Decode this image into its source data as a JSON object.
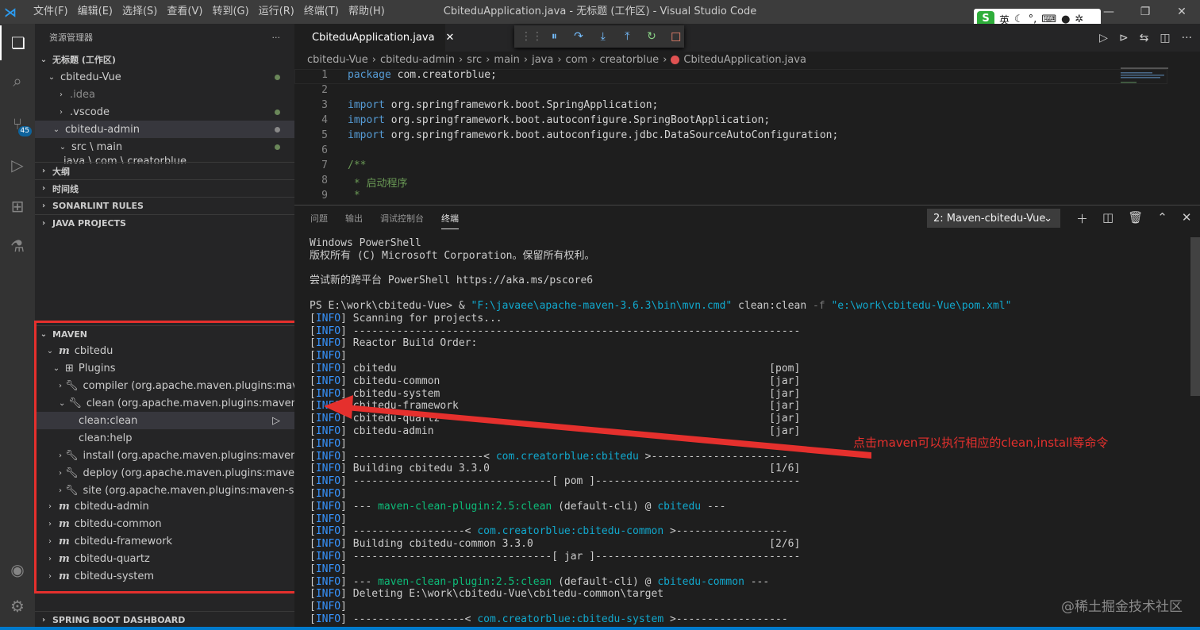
{
  "menu": [
    "文件(F)",
    "编辑(E)",
    "选择(S)",
    "查看(V)",
    "转到(G)",
    "运行(R)",
    "终端(T)",
    "帮助(H)"
  ],
  "window_title": "CbiteduApplication.java - 无标题 (工作区) - Visual Studio Code",
  "ime": {
    "mark": "S",
    "lang": "英"
  },
  "activity": {
    "scm_badge": "45"
  },
  "sidebar": {
    "header": "资源管理器",
    "more": "···",
    "workspace": "无标题 (工作区)",
    "tree": [
      "cbitedu-Vue",
      ".idea",
      ".vscode",
      "cbitedu-admin",
      "src \\ main",
      "java \\ com \\ creatorblue"
    ],
    "sections": [
      "大纲",
      "时间线",
      "SONARLINT RULES",
      "JAVA PROJECTS",
      "MAVEN",
      "SPRING BOOT DASHBOARD"
    ],
    "maven": {
      "root": "cbitedu",
      "plugins": "Plugins",
      "items": [
        "compiler (org.apache.maven.plugins:mav...",
        "clean (org.apache.maven.plugins:maven-c...",
        "clean:clean",
        "clean:help",
        "install (org.apache.maven.plugins:maven-...",
        "deploy (org.apache.maven.plugins:maven...",
        "site (org.apache.maven.plugins:maven-sit..."
      ],
      "modules": [
        "cbitedu-admin",
        "cbitedu-common",
        "cbitedu-framework",
        "cbitedu-quartz",
        "cbitedu-system"
      ]
    }
  },
  "editor": {
    "tab": "CbiteduApplication.java",
    "breadcrumb": [
      "cbitedu-Vue",
      "cbitedu-admin",
      "src",
      "main",
      "java",
      "com",
      "creatorblue",
      "CbiteduApplication.java"
    ],
    "lines": [
      "1",
      "2",
      "3",
      "4",
      "5",
      "6",
      "7",
      "8",
      "9"
    ],
    "code": {
      "l1a": "package",
      "l1b": " com.creatorblue;",
      "imp": "import",
      "l3": " org.springframework.boot.SpringApplication;",
      "l4": " org.springframework.boot.autoconfigure.SpringBootApplication;",
      "l5": " org.springframework.boot.autoconfigure.jdbc.DataSourceAutoConfiguration;",
      "l7": "/**",
      "l8": " * 启动程序",
      "l9": " *"
    }
  },
  "panel": {
    "tabs": [
      "问题",
      "输出",
      "调试控制台",
      "终端"
    ],
    "terminal_select": "2: Maven-cbitedu-Vue"
  },
  "terminal": {
    "t1": "Windows PowerShell",
    "t2": "版权所有 (C) Microsoft Corporation。保留所有权利。",
    "t3": "尝试新的跨平台 PowerShell https://aka.ms/pscore6",
    "ps": "PS E:\\work\\cbitedu-Vue> & ",
    "cmd": "\"F:\\javaee\\apache-maven-3.6.3\\bin\\mvn.cmd\"",
    "goal": " clean:clean ",
    "flag": "-f",
    "pom": " \"e:\\work\\cbitedu-Vue\\pom.xml\"",
    "info": "INFO",
    "lines": [
      " Scanning for projects...",
      " ------------------------------------------------------------------------",
      " Reactor Build Order:",
      "",
      " cbitedu                                                            [pom]",
      " cbitedu-common                                                     [jar]",
      " cbitedu-system                                                     [jar]",
      " cbitedu-framework                                                  [jar]",
      " cbitedu-quartz                                                     [jar]",
      " cbitedu-admin                                                      [jar]",
      ""
    ],
    "sep1a": " ---------------------< ",
    "sep1b": "com.creatorblue:cbitedu",
    "sep1c": " >----------------------",
    "b1": " Building cbitedu 3.3.0                                             [1/6]",
    "pom_line": " --------------------------------[ pom ]---------------------------------",
    "clean1a": " --- ",
    "clean1b": "maven-clean-plugin:2.5:clean",
    "clean1c": " (default-cli) @ ",
    "clean1d": "cbitedu",
    "clean1e": " ---",
    "sep2a": " ------------------< ",
    "sep2b": "com.creatorblue:cbitedu-common",
    "sep2c": " >------------------",
    "b2": " Building cbitedu-common 3.3.0                                      [2/6]",
    "jar_line": " --------------------------------[ jar ]---------------------------------",
    "clean2d": "cbitedu-common",
    "del": " Deleting E:\\work\\cbitedu-Vue\\cbitedu-common\\target",
    "sep3b": "com.creatorblue:cbitedu-system"
  },
  "annotation": "点击maven可以执行相应的clean,install等命令",
  "watermark": "@稀土掘金技术社区",
  "colors": {
    "accent": "#007acc",
    "annotation": "#e5302d"
  }
}
